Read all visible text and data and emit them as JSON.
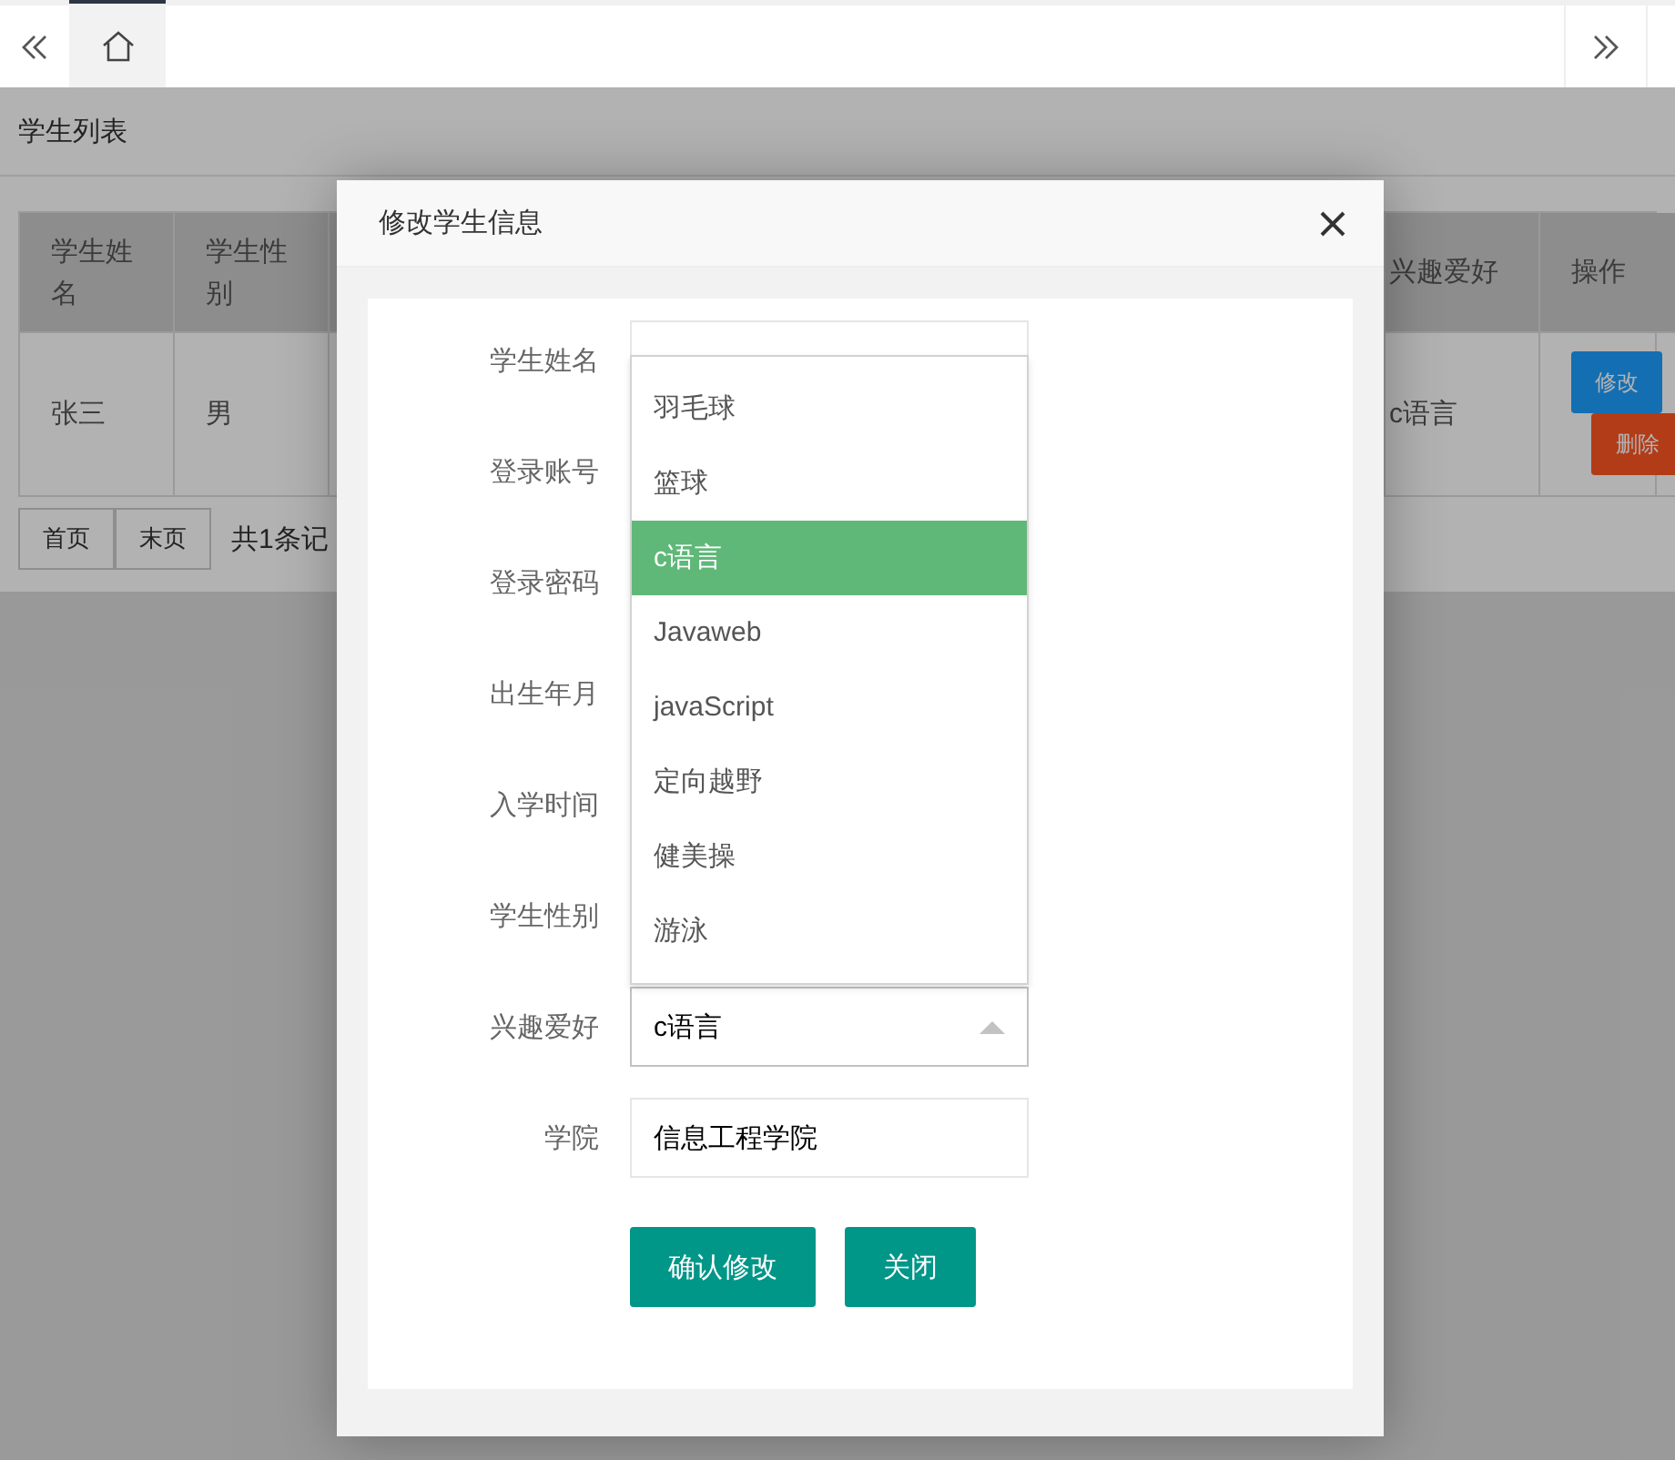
{
  "tab_bar": {
    "tabs": [
      {
        "selected": true
      }
    ]
  },
  "panel": {
    "title": "学生列表",
    "table": {
      "columns": [
        "学生姓名",
        "学生性别",
        "兴趣爱好",
        "操作"
      ],
      "rows": [
        {
          "cells": [
            "张三",
            "男",
            "c语言"
          ],
          "actions": [
            {
              "kind": "edit",
              "label": "修改"
            },
            {
              "kind": "delete",
              "label": "删除"
            }
          ]
        }
      ]
    },
    "pagination": {
      "buttons": [
        "首页",
        "末页"
      ],
      "summary": "共1条记"
    }
  },
  "dialog": {
    "title": "修改学生信息",
    "fields": [
      {
        "label": "学生姓名",
        "kind": "text"
      },
      {
        "label": "登录账号",
        "kind": "covered"
      },
      {
        "label": "登录密码",
        "kind": "covered"
      },
      {
        "label": "出生年月",
        "kind": "covered"
      },
      {
        "label": "入学时间",
        "kind": "covered"
      },
      {
        "label": "学生性别",
        "kind": "covered"
      },
      {
        "label": "兴趣爱好",
        "kind": "select",
        "value": "c语言",
        "expanded": true
      },
      {
        "label": "学院",
        "kind": "text",
        "value": "信息工程学院"
      }
    ],
    "options": [
      {
        "label": "羽毛球",
        "selected": false
      },
      {
        "label": "篮球",
        "selected": false
      },
      {
        "label": "c语言",
        "selected": true
      },
      {
        "label": "Javaweb",
        "selected": false
      },
      {
        "label": "javaScript",
        "selected": false
      },
      {
        "label": "定向越野",
        "selected": false
      },
      {
        "label": "健美操",
        "selected": false
      },
      {
        "label": "游泳",
        "selected": false
      }
    ],
    "buttons": [
      "确认修改",
      "关闭"
    ]
  }
}
